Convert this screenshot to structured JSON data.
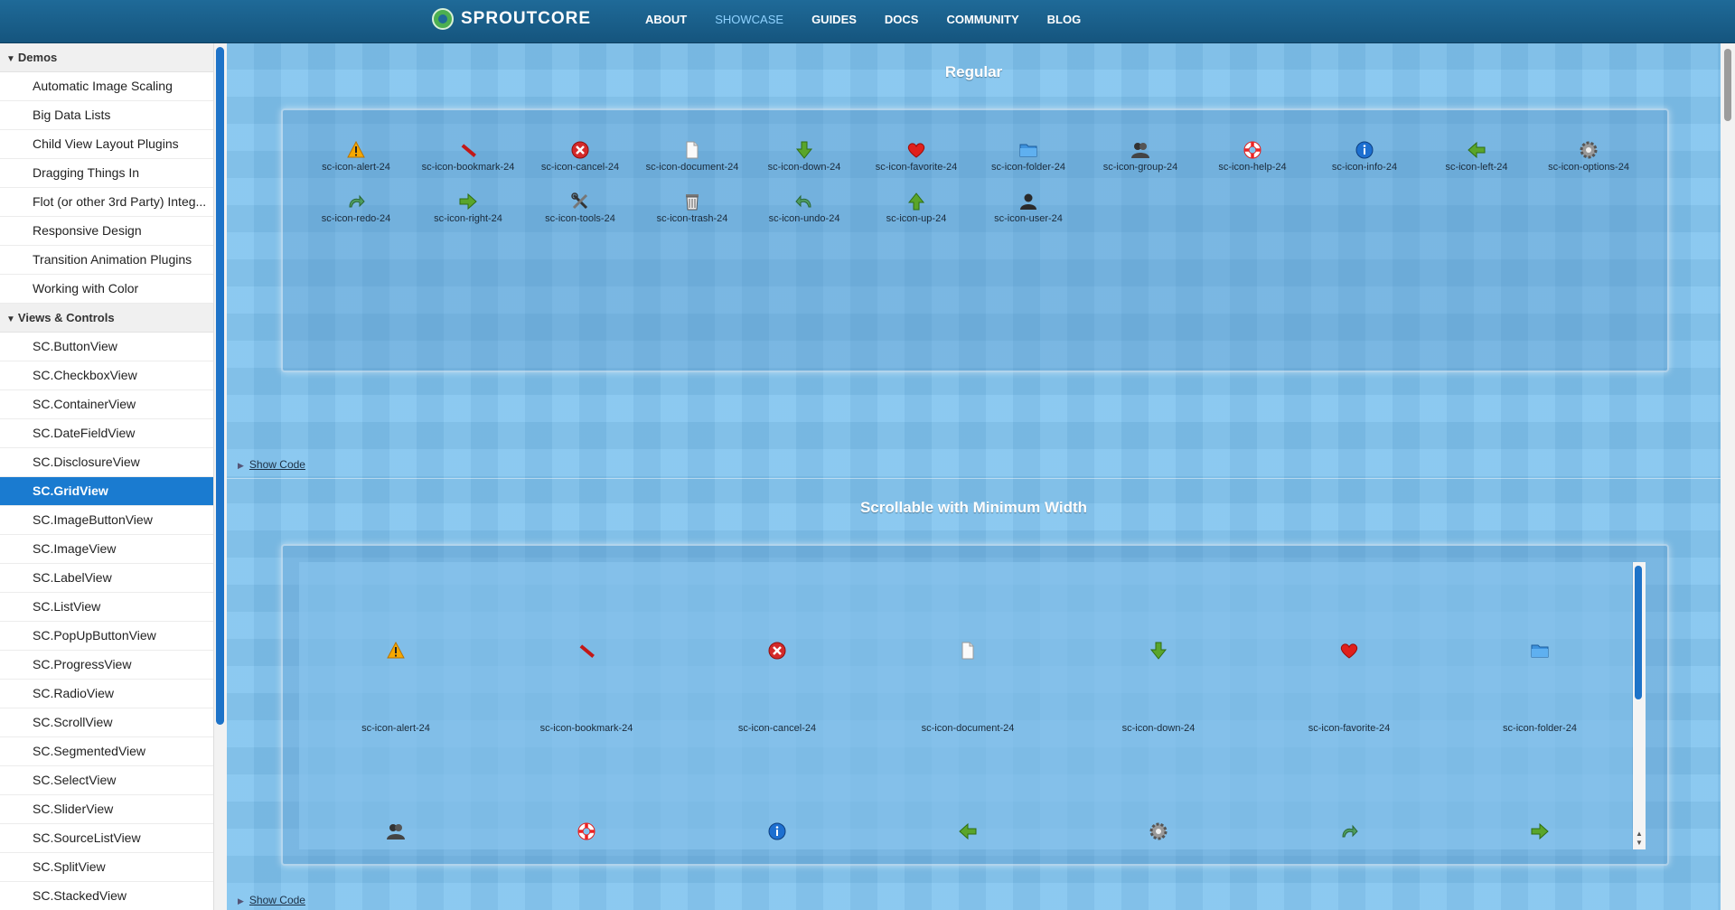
{
  "header": {
    "brand": "SPROUTCORE",
    "nav": [
      {
        "label": "ABOUT",
        "active": false
      },
      {
        "label": "SHOWCASE",
        "active": true
      },
      {
        "label": "GUIDES",
        "active": false
      },
      {
        "label": "DOCS",
        "active": false
      },
      {
        "label": "COMMUNITY",
        "active": false
      },
      {
        "label": "BLOG",
        "active": false
      }
    ]
  },
  "sidebar": {
    "groups": [
      {
        "label": "Demos",
        "items": [
          "Automatic Image Scaling",
          "Big Data Lists",
          "Child View Layout Plugins",
          "Dragging Things In",
          "Flot (or other 3rd Party) Integ...",
          "Responsive Design",
          "Transition Animation Plugins",
          "Working with Color"
        ]
      },
      {
        "label": "Views & Controls",
        "items": [
          "SC.ButtonView",
          "SC.CheckboxView",
          "SC.ContainerView",
          "SC.DateFieldView",
          "SC.DisclosureView",
          "SC.GridView",
          "SC.ImageButtonView",
          "SC.ImageView",
          "SC.LabelView",
          "SC.ListView",
          "SC.PopUpButtonView",
          "SC.ProgressView",
          "SC.RadioView",
          "SC.ScrollView",
          "SC.SegmentedView",
          "SC.SelectView",
          "SC.SliderView",
          "SC.SourceListView",
          "SC.SplitView",
          "SC.StackedView"
        ]
      }
    ],
    "selected": "SC.GridView"
  },
  "sections": [
    {
      "title": "Regular",
      "show_code": "Show Code",
      "icons": [
        {
          "label": "sc-icon-alert-24",
          "icon": "alert-icon"
        },
        {
          "label": "sc-icon-bookmark-24",
          "icon": "bookmark-icon"
        },
        {
          "label": "sc-icon-cancel-24",
          "icon": "cancel-icon"
        },
        {
          "label": "sc-icon-document-24",
          "icon": "document-icon"
        },
        {
          "label": "sc-icon-down-24",
          "icon": "down-arrow-icon"
        },
        {
          "label": "sc-icon-favorite-24",
          "icon": "heart-icon"
        },
        {
          "label": "sc-icon-folder-24",
          "icon": "folder-icon"
        },
        {
          "label": "sc-icon-group-24",
          "icon": "group-icon"
        },
        {
          "label": "sc-icon-help-24",
          "icon": "lifebuoy-icon"
        },
        {
          "label": "sc-icon-info-24",
          "icon": "info-icon"
        },
        {
          "label": "sc-icon-left-24",
          "icon": "left-arrow-icon"
        },
        {
          "label": "sc-icon-options-24",
          "icon": "gear-icon"
        },
        {
          "label": "sc-icon-redo-24",
          "icon": "redo-icon"
        },
        {
          "label": "sc-icon-right-24",
          "icon": "right-arrow-icon"
        },
        {
          "label": "sc-icon-tools-24",
          "icon": "tools-icon"
        },
        {
          "label": "sc-icon-trash-24",
          "icon": "trash-icon"
        },
        {
          "label": "sc-icon-undo-24",
          "icon": "undo-icon"
        },
        {
          "label": "sc-icon-up-24",
          "icon": "up-arrow-icon"
        },
        {
          "label": "sc-icon-user-24",
          "icon": "user-icon"
        }
      ]
    },
    {
      "title": "Scrollable with Minimum Width",
      "show_code": "Show Code",
      "icons": [
        {
          "label": "sc-icon-alert-24",
          "icon": "alert-icon"
        },
        {
          "label": "sc-icon-bookmark-24",
          "icon": "bookmark-icon"
        },
        {
          "label": "sc-icon-cancel-24",
          "icon": "cancel-icon"
        },
        {
          "label": "sc-icon-document-24",
          "icon": "document-icon"
        },
        {
          "label": "sc-icon-down-24",
          "icon": "down-arrow-icon"
        },
        {
          "label": "sc-icon-favorite-24",
          "icon": "heart-icon"
        },
        {
          "label": "sc-icon-folder-24",
          "icon": "folder-icon"
        }
      ],
      "icons_row2": [
        {
          "icon": "group-icon"
        },
        {
          "icon": "lifebuoy-icon"
        },
        {
          "icon": "info-icon"
        },
        {
          "icon": "left-arrow-icon"
        },
        {
          "icon": "gear-icon"
        },
        {
          "icon": "redo-icon"
        },
        {
          "icon": "right-arrow-icon"
        }
      ]
    }
  ],
  "colors": {
    "header_bg": "#1a5f8c",
    "nav_active": "#8fd2ff",
    "selection": "#1a7bd0",
    "panel_bg": "#7fc3ef"
  }
}
